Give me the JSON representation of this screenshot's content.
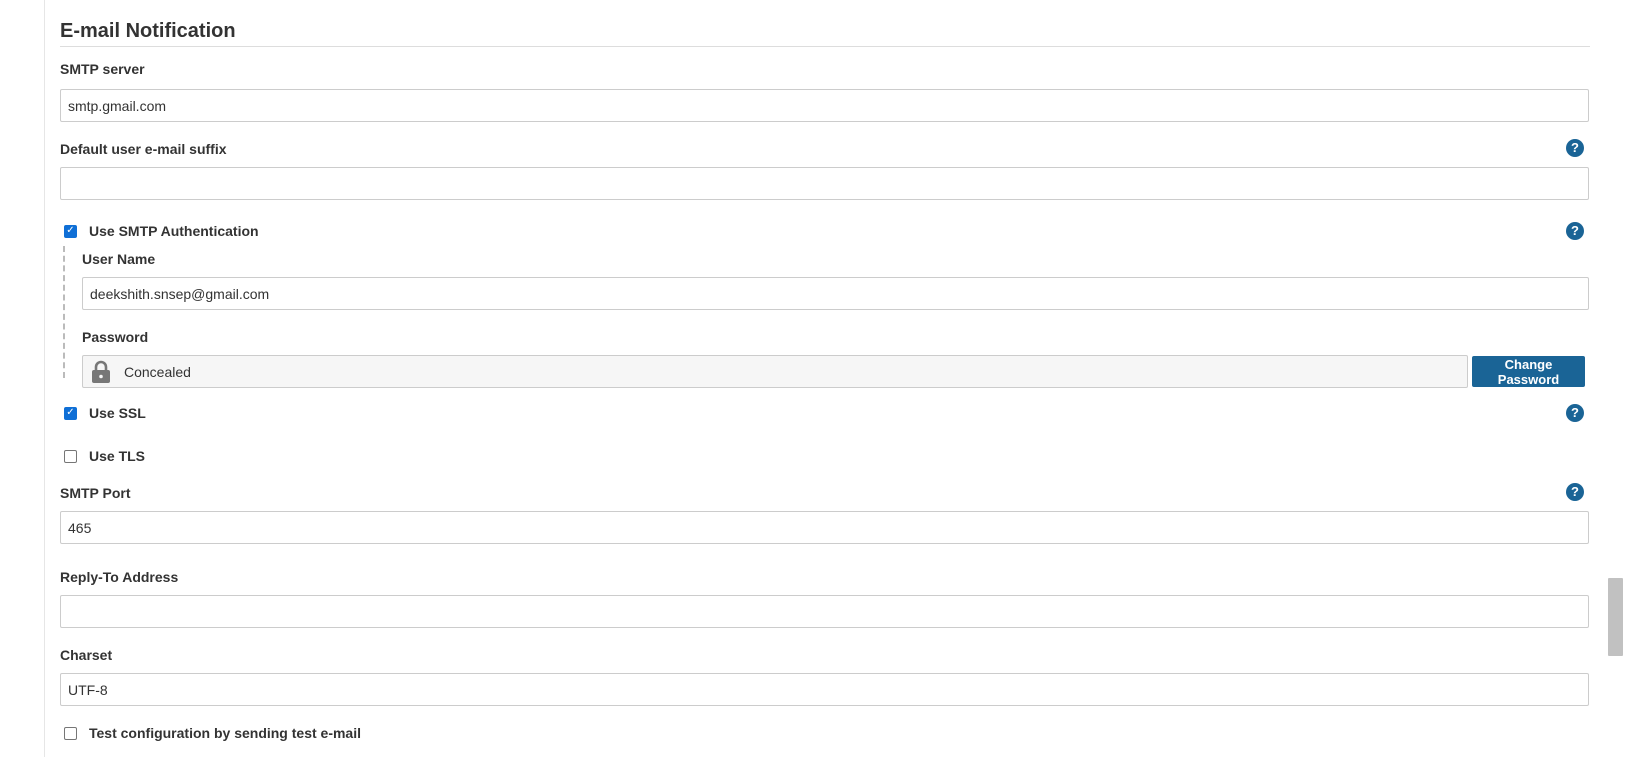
{
  "section": {
    "title": "E-mail Notification"
  },
  "smtp_server": {
    "label": "SMTP server",
    "value": "smtp.gmail.com"
  },
  "default_suffix": {
    "label": "Default user e-mail suffix",
    "value": ""
  },
  "smtp_auth": {
    "label": "Use SMTP Authentication",
    "checked": true,
    "username": {
      "label": "User Name",
      "value": "deekshith.snsep@gmail.com"
    },
    "password": {
      "label": "Password",
      "concealed_text": "Concealed",
      "change_button": "Change Password"
    }
  },
  "use_ssl": {
    "label": "Use SSL",
    "checked": true
  },
  "use_tls": {
    "label": "Use TLS",
    "checked": false
  },
  "smtp_port": {
    "label": "SMTP Port",
    "value": "465"
  },
  "reply_to": {
    "label": "Reply-To Address",
    "value": ""
  },
  "charset": {
    "label": "Charset",
    "value": "UTF-8"
  },
  "test_config": {
    "label": "Test configuration by sending test e-mail",
    "checked": false
  },
  "help_glyph": "?",
  "check_glyph": "✓",
  "colors": {
    "accent": "#1a6496",
    "checkbox_checked": "#0f6fd6",
    "input_border": "#cccccc",
    "concealed_bg": "#f6f6f6"
  },
  "icons": {
    "help": "help-icon",
    "lock": "lock-icon",
    "check": "check-icon"
  }
}
